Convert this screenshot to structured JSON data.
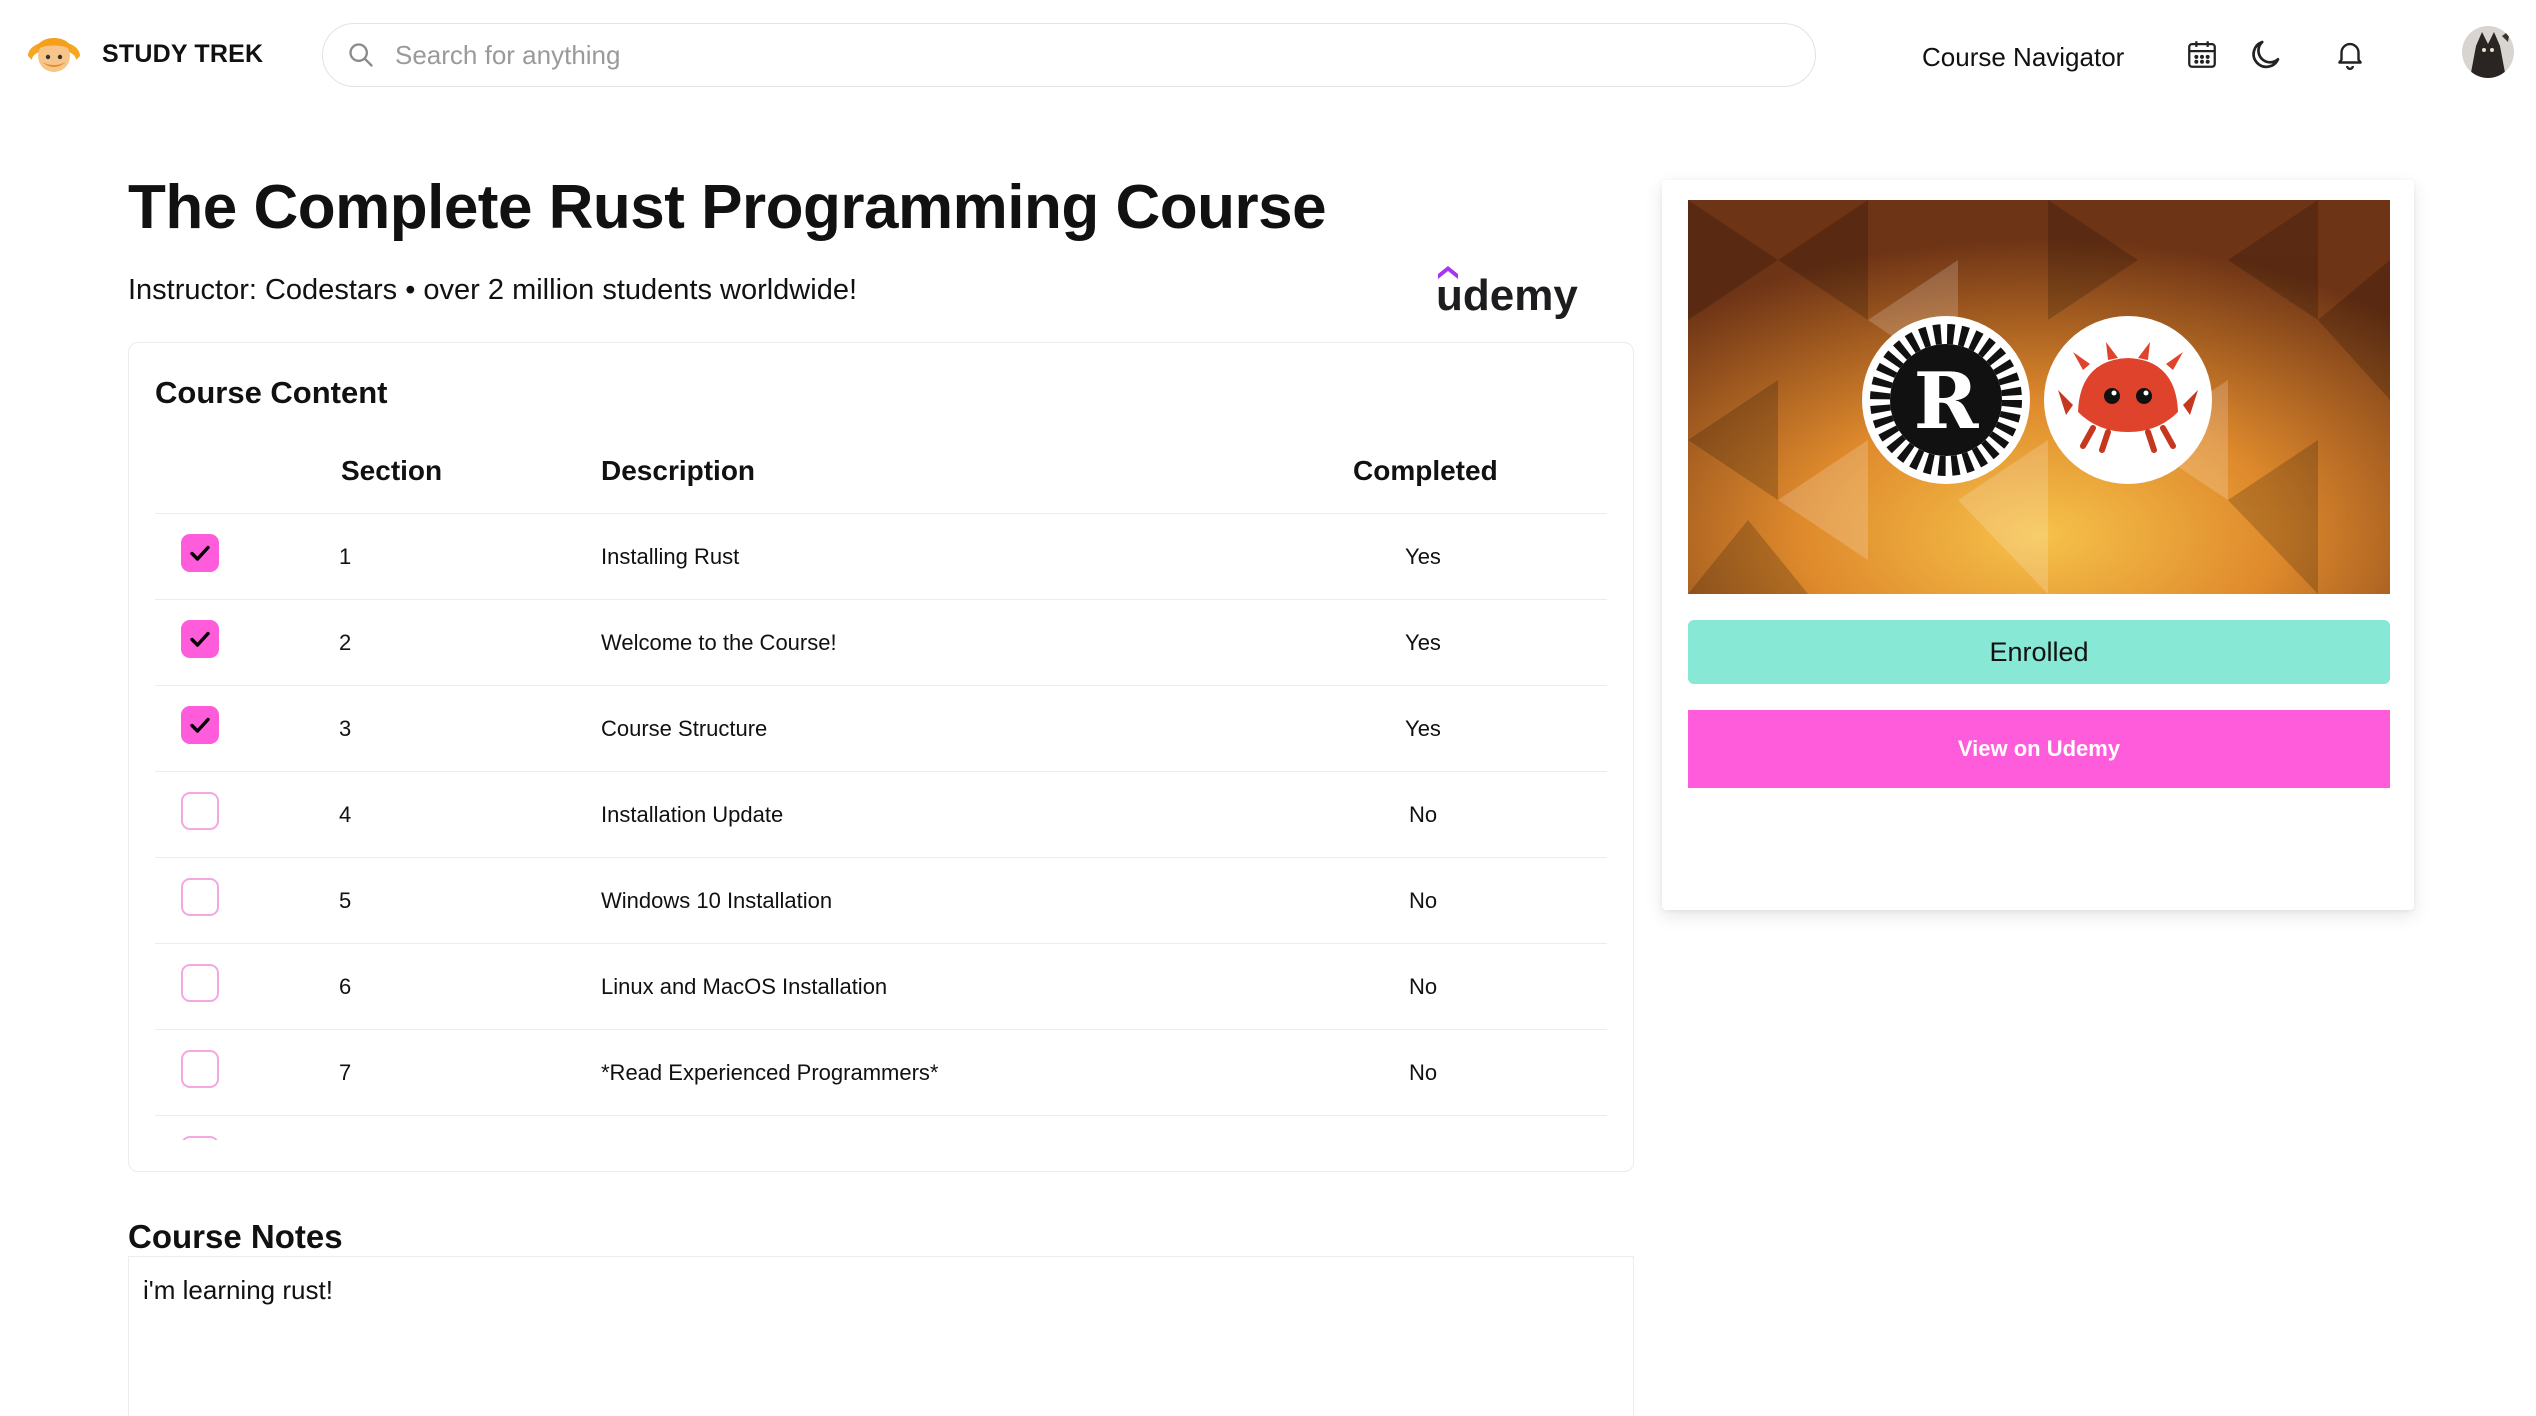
{
  "header": {
    "brand": "STUDY TREK",
    "search_placeholder": "Search for anything",
    "nav_link": "Course Navigator"
  },
  "course": {
    "title": "The Complete Rust Programming Course",
    "subtitle": "Instructor: Codestars • over 2 million students worldwide!",
    "platform": "udemy"
  },
  "content": {
    "title": "Course Content",
    "columns": [
      "Section",
      "Description",
      "Completed"
    ],
    "rows": [
      {
        "section": "1",
        "description": "Installing Rust",
        "completed": "Yes",
        "checked": true
      },
      {
        "section": "2",
        "description": "Welcome to the Course!",
        "completed": "Yes",
        "checked": true
      },
      {
        "section": "3",
        "description": "Course Structure",
        "completed": "Yes",
        "checked": true
      },
      {
        "section": "4",
        "description": "Installation Update",
        "completed": "No",
        "checked": false
      },
      {
        "section": "5",
        "description": "Windows 10 Installation",
        "completed": "No",
        "checked": false
      },
      {
        "section": "6",
        "description": "Linux and MacOS Installation",
        "completed": "No",
        "checked": false
      },
      {
        "section": "7",
        "description": "*Read Experienced Programmers*",
        "completed": "No",
        "checked": false
      }
    ]
  },
  "notes": {
    "title": "Course Notes",
    "value": "i'm learning rust!"
  },
  "side": {
    "status_label": "Enrolled",
    "view_label": "View on Udemy"
  },
  "colors": {
    "accent_pink": "#ff5cdb",
    "enrolled_green": "#86e8d5"
  },
  "icons": [
    "search-icon",
    "calendar-icon",
    "moon-icon",
    "bell-icon",
    "check-icon"
  ]
}
